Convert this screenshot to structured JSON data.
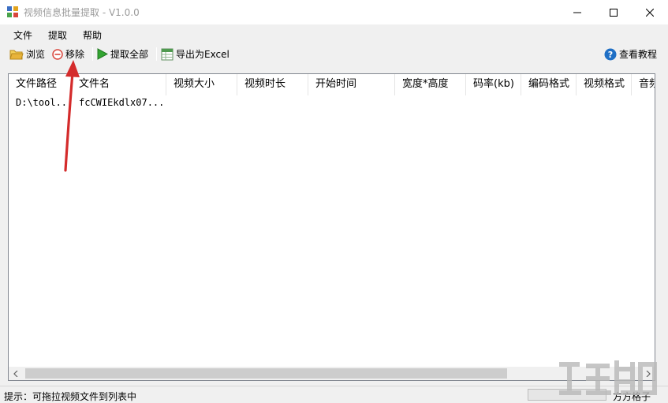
{
  "window": {
    "title": "视频信息批量提取 - V1.0.0",
    "controls": [
      "minimize",
      "maximize",
      "close"
    ]
  },
  "menu": [
    {
      "label": "文件"
    },
    {
      "label": "提取"
    },
    {
      "label": "帮助"
    }
  ],
  "toolbar": {
    "browse": {
      "label": "浏览",
      "icon": "folder-open-icon"
    },
    "remove": {
      "label": "移除",
      "icon": "remove-circle-icon"
    },
    "extract_all": {
      "label": "提取全部",
      "icon": "play-icon"
    },
    "export": {
      "label": "导出为Excel",
      "icon": "excel-icon"
    },
    "tutorial": {
      "label": "查看教程",
      "icon": "help-icon"
    }
  },
  "table": {
    "columns": [
      "文件路径",
      "文件名",
      "视频大小",
      "视频时长",
      "开始时间",
      "宽度*高度",
      "码率(kb)",
      "编码格式",
      "视频格式",
      "音频"
    ],
    "rows": [
      [
        "D:\\tool...",
        "fcCWIEkdlx07...",
        "",
        "",
        "",
        "",
        "",
        "",
        "",
        ""
      ]
    ]
  },
  "statusbar": {
    "hint": "提示：可拖拉视频文件到列表中",
    "user": "方方格子"
  },
  "colors": {
    "title_text": "#9a9a9a",
    "annotation_arrow": "#d42b2b",
    "remove_icon": "#d9453b",
    "play_icon": "#33a532",
    "help_icon": "#1f6fc5",
    "folder_icon": "#e8b33a"
  }
}
